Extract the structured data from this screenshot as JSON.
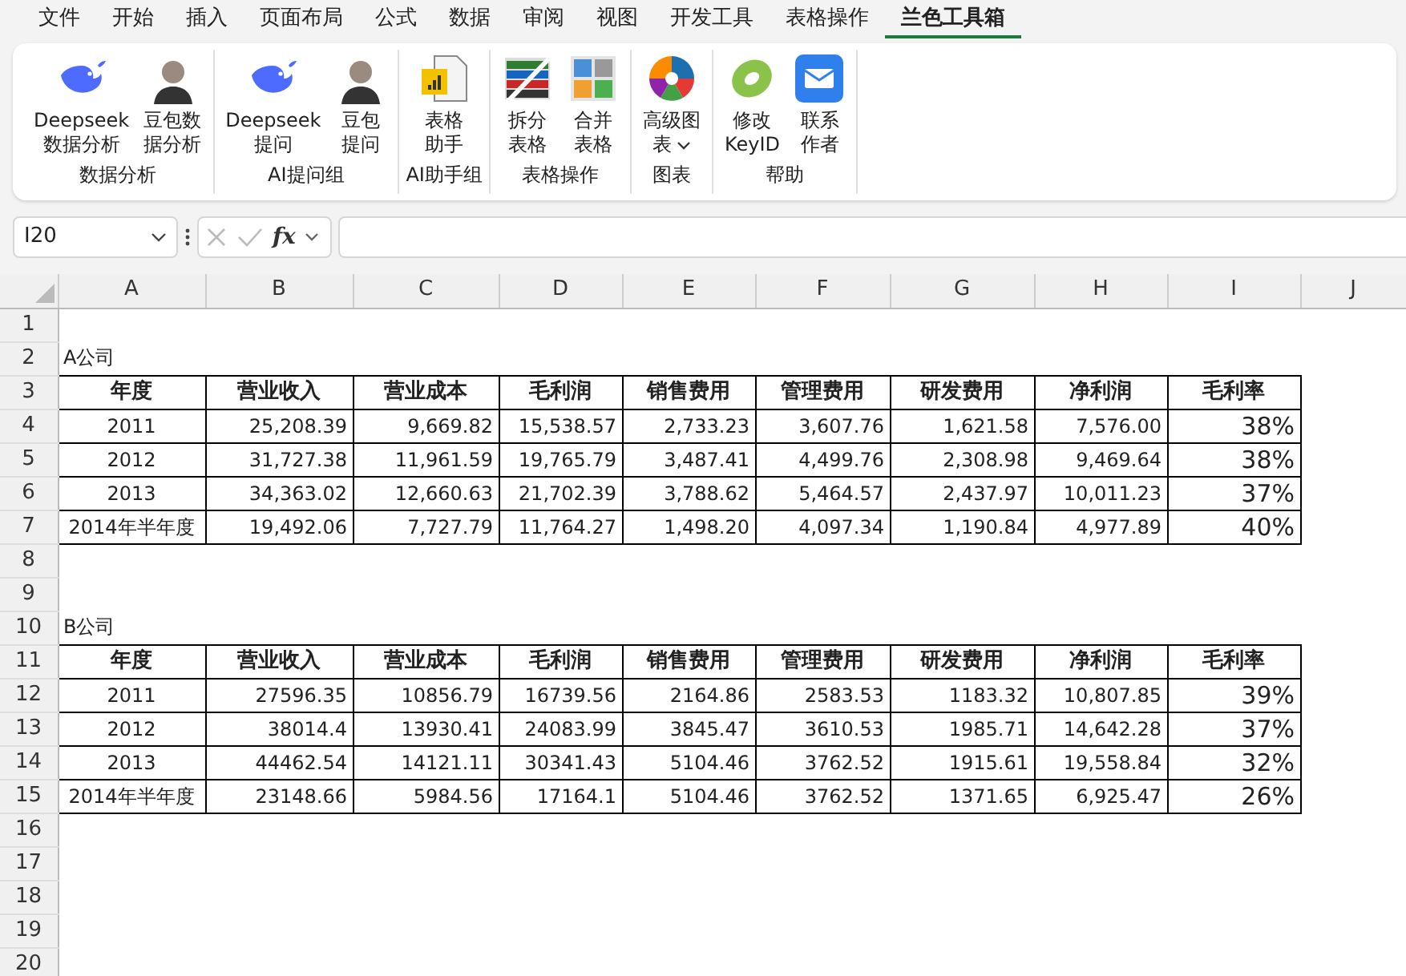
{
  "menu_tabs": [
    {
      "label": "文件",
      "selected": false
    },
    {
      "label": "开始",
      "selected": false
    },
    {
      "label": "插入",
      "selected": false
    },
    {
      "label": "页面布局",
      "selected": false
    },
    {
      "label": "公式",
      "selected": false
    },
    {
      "label": "数据",
      "selected": false
    },
    {
      "label": "审阅",
      "selected": false
    },
    {
      "label": "视图",
      "selected": false
    },
    {
      "label": "开发工具",
      "selected": false
    },
    {
      "label": "表格操作",
      "selected": false
    },
    {
      "label": "兰色工具箱",
      "selected": true
    }
  ],
  "ribbon_groups": [
    {
      "label": "数据分析",
      "buttons": [
        {
          "kind": "whale",
          "lines": [
            "Deepseek",
            "数据分析"
          ]
        },
        {
          "kind": "avatar",
          "lines": [
            "豆包数",
            "据分析"
          ]
        }
      ]
    },
    {
      "label": "AI提问组",
      "buttons": [
        {
          "kind": "whale",
          "lines": [
            "Deepseek",
            "提问"
          ]
        },
        {
          "kind": "avatar",
          "lines": [
            "豆包",
            "提问"
          ]
        }
      ]
    },
    {
      "label": "AI助手组",
      "buttons": [
        {
          "kind": "sheetchart",
          "lines": [
            "表格",
            "助手"
          ]
        }
      ]
    },
    {
      "label": "表格操作",
      "buttons": [
        {
          "kind": "split",
          "lines": [
            "拆分",
            "表格"
          ]
        },
        {
          "kind": "merge",
          "lines": [
            "合并",
            "表格"
          ]
        }
      ]
    },
    {
      "label": "图表",
      "buttons": [
        {
          "kind": "pie",
          "lines": [
            "高级图",
            "表"
          ],
          "dropdown": true
        }
      ]
    },
    {
      "label": "帮助",
      "buttons": [
        {
          "kind": "ring",
          "lines": [
            "修改",
            "KeyID"
          ]
        },
        {
          "kind": "mail",
          "lines": [
            "联系",
            "作者"
          ]
        }
      ]
    }
  ],
  "formula_bar": {
    "name_box": "I20",
    "function_label": "fx"
  },
  "sheet": {
    "columns": [
      "A",
      "B",
      "C",
      "D",
      "E",
      "F",
      "G",
      "H",
      "I",
      "J"
    ],
    "rows": [
      {
        "number": "1",
        "kind": "blank"
      },
      {
        "number": "2",
        "kind": "title",
        "text": "A公司"
      },
      {
        "number": "3",
        "kind": "header",
        "cells": [
          "年度",
          "营业收入",
          "营业成本",
          "毛利润",
          "销售费用",
          "管理费用",
          "研发费用",
          "净利润",
          "毛利率"
        ]
      },
      {
        "number": "4",
        "kind": "data",
        "cells": [
          "2011",
          "25,208.39",
          "9,669.82",
          "15,538.57",
          "2,733.23",
          "3,607.76",
          "1,621.58",
          "7,576.00",
          "38%"
        ]
      },
      {
        "number": "5",
        "kind": "data",
        "cells": [
          "2012",
          "31,727.38",
          "11,961.59",
          "19,765.79",
          "3,487.41",
          "4,499.76",
          "2,308.98",
          "9,469.64",
          "38%"
        ]
      },
      {
        "number": "6",
        "kind": "data",
        "cells": [
          "2013",
          "34,363.02",
          "12,660.63",
          "21,702.39",
          "3,788.62",
          "5,464.57",
          "2,437.97",
          "10,011.23",
          "37%"
        ]
      },
      {
        "number": "7",
        "kind": "data",
        "cells": [
          "2014年半年度",
          "19,492.06",
          "7,727.79",
          "11,764.27",
          "1,498.20",
          "4,097.34",
          "1,190.84",
          "4,977.89",
          "40%"
        ]
      },
      {
        "number": "8",
        "kind": "blank"
      },
      {
        "number": "9",
        "kind": "blank"
      },
      {
        "number": "10",
        "kind": "title",
        "text": "B公司"
      },
      {
        "number": "11",
        "kind": "header",
        "cells": [
          "年度",
          "营业收入",
          "营业成本",
          "毛利润",
          "销售费用",
          "管理费用",
          "研发费用",
          "净利润",
          "毛利率"
        ]
      },
      {
        "number": "12",
        "kind": "data",
        "cells": [
          "2011",
          "27596.35",
          "10856.79",
          "16739.56",
          "2164.86",
          "2583.53",
          "1183.32",
          "10,807.85",
          "39%"
        ]
      },
      {
        "number": "13",
        "kind": "data",
        "cells": [
          "2012",
          "38014.4",
          "13930.41",
          "24083.99",
          "3845.47",
          "3610.53",
          "1985.71",
          "14,642.28",
          "37%"
        ]
      },
      {
        "number": "14",
        "kind": "data",
        "cells": [
          "2013",
          "44462.54",
          "14121.11",
          "30341.43",
          "5104.46",
          "3762.52",
          "1915.61",
          "19,558.84",
          "32%"
        ]
      },
      {
        "number": "15",
        "kind": "data",
        "cells": [
          "2014年半年度",
          "23148.66",
          "5984.56",
          "17164.1",
          "5104.46",
          "3762.52",
          "1371.65",
          "6,925.47",
          "26%"
        ]
      },
      {
        "number": "16",
        "kind": "blank"
      },
      {
        "number": "17",
        "kind": "blank"
      },
      {
        "number": "18",
        "kind": "blank"
      },
      {
        "number": "19",
        "kind": "blank"
      },
      {
        "number": "20",
        "kind": "blank"
      }
    ]
  }
}
